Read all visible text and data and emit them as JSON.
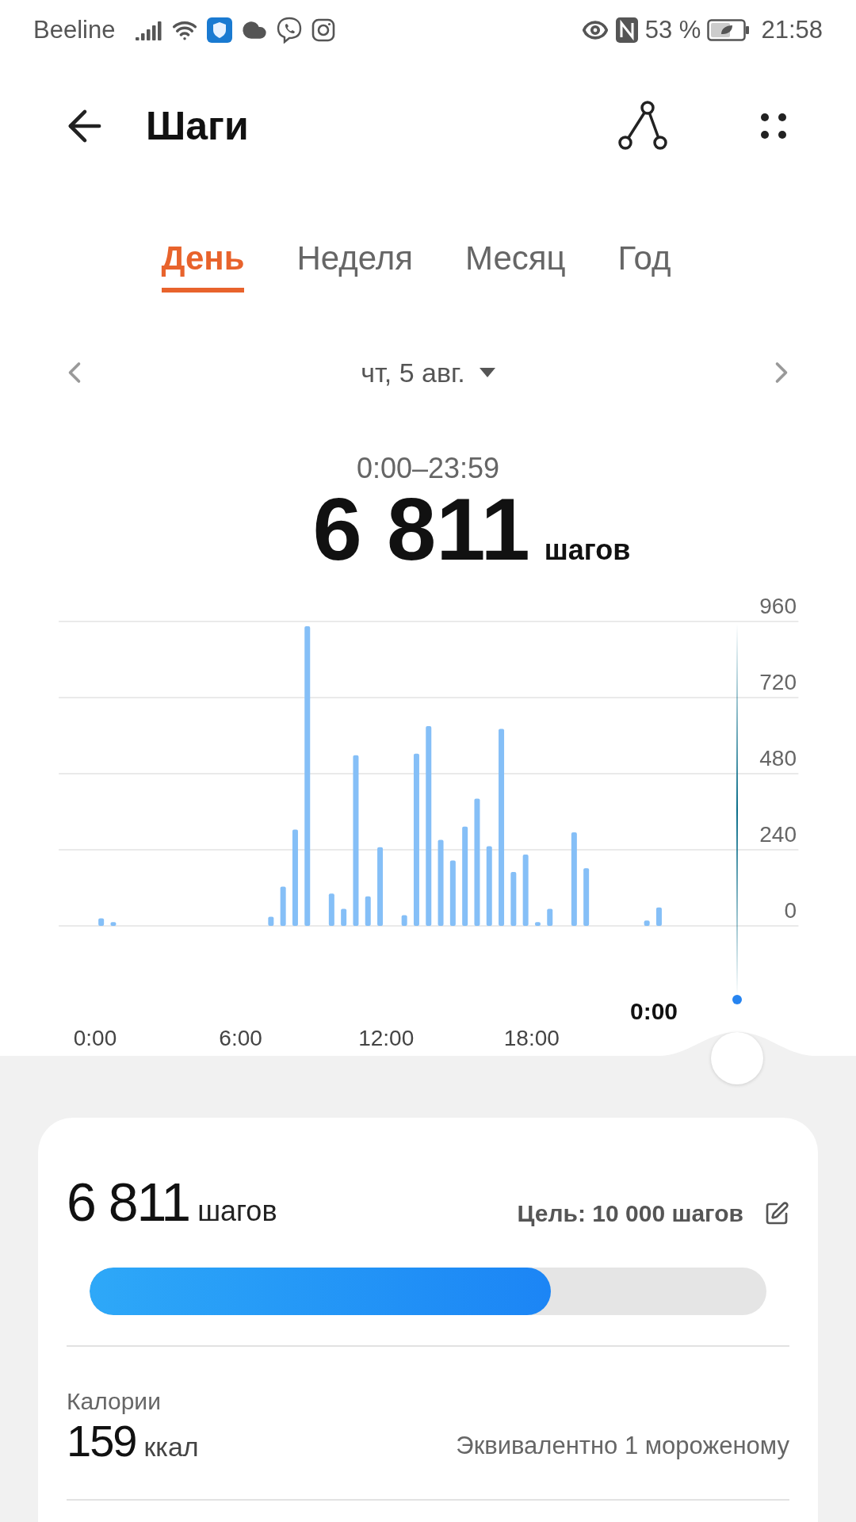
{
  "status_bar": {
    "carrier": "Beeline",
    "battery": "53 %",
    "time": "21:58"
  },
  "header": {
    "title": "Шаги"
  },
  "tabs": [
    {
      "label": "День",
      "selected": true
    },
    {
      "label": "Неделя",
      "selected": false
    },
    {
      "label": "Месяц",
      "selected": false
    },
    {
      "label": "Год",
      "selected": false
    }
  ],
  "date": {
    "label": "чт, 5 авг."
  },
  "summary": {
    "range": "0:00–23:59",
    "steps": "6 811",
    "unit": "шагов"
  },
  "chart": {
    "cursor_label": "0:00",
    "chart_data": {
      "type": "bar",
      "x": [
        0.25,
        0.75,
        7.25,
        7.75,
        8.25,
        8.75,
        9.75,
        10.25,
        10.75,
        11.25,
        11.75,
        12.75,
        13.25,
        13.75,
        14.25,
        14.75,
        15.25,
        15.75,
        16.25,
        16.75,
        17.25,
        17.75,
        18.25,
        18.75,
        19.75,
        20.25,
        22.75,
        23.25
      ],
      "values": [
        24,
        12,
        29,
        124,
        304,
        945,
        102,
        54,
        538,
        93,
        248,
        34,
        543,
        630,
        271,
        206,
        313,
        401,
        251,
        621,
        170,
        225,
        12,
        54,
        295,
        182,
        17,
        58
      ],
      "xlim": [
        -1.5,
        29
      ],
      "ylim": [
        0,
        960
      ],
      "xticks": [
        {
          "value": 0,
          "label": "0:00"
        },
        {
          "value": 6,
          "label": "6:00"
        },
        {
          "value": 12,
          "label": "12:00"
        },
        {
          "value": 18,
          "label": "18:00"
        }
      ],
      "yticks": [
        0,
        240,
        480,
        720,
        960
      ],
      "grid": true
    }
  },
  "card": {
    "steps": "6 811",
    "unit": "шагов",
    "goal": "Цель: 10 000 шагов",
    "level": 0.6811,
    "calories": {
      "label": "Калории",
      "value": "159",
      "unit": "ккал",
      "equivalent": "Эквивалентно 1 мороженому"
    }
  }
}
